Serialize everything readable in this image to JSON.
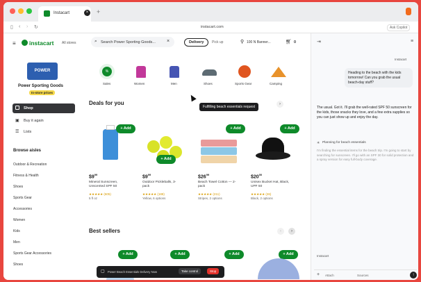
{
  "browser": {
    "tab_title": "Instacart",
    "url": "instacart.com",
    "right_pill": "Ask Copilot"
  },
  "header": {
    "logo": "instacart",
    "stores": "All stores",
    "search_placeholder": "Search Power Sporting Goods...",
    "delivery": "Delivery",
    "pickup": "Pick up",
    "address": "100 N Banner...",
    "cart_count": "0"
  },
  "store": {
    "badge": "POWER",
    "name": "Power Sporting Goods",
    "status": "In-store prices"
  },
  "nav": {
    "shop": "Shop",
    "buy_again": "Buy it again",
    "lists": "Lists"
  },
  "aisles": {
    "heading": "Browse aisles",
    "items": [
      "Outdoor & Recreation",
      "Fitness & Health",
      "Shoes",
      "Sports Gear",
      "Accessories",
      "Women",
      "Kids",
      "Men",
      "Sports Gear Accessories",
      "Shoes"
    ]
  },
  "categories": [
    {
      "label": "Sales",
      "icon": "sale-icon"
    },
    {
      "label": "Women",
      "icon": "shirt-icon"
    },
    {
      "label": "Men",
      "icon": "shirt-icon"
    },
    {
      "label": "Shoes",
      "icon": "shoe-icon"
    },
    {
      "label": "Sports Gear",
      "icon": "ball-icon"
    },
    {
      "label": "Camping",
      "icon": "tent-icon"
    }
  ],
  "deals": {
    "heading": "Deals for you",
    "tooltip": "Fulfilling beach essentials request",
    "add_label": "+ Add",
    "products": [
      {
        "price": "$9",
        "cents": "99",
        "name": "Mineral Sunscreen, Unscented SPF 50",
        "rating": "★★★★★ (605)",
        "detail": "5 fl oz"
      },
      {
        "price": "$9",
        "cents": "99",
        "name": "Outdoor Pickleballs, 3-pack",
        "rating": "★★★★★ (188)",
        "detail": "Yellow, 6 options"
      },
      {
        "price": "$26",
        "cents": "99",
        "name": "Beach Towel Cotton — 2-pack",
        "rating": "★★★★★ (211)",
        "detail": "Stripes, 2 options"
      },
      {
        "price": "$20",
        "cents": "00",
        "name": "Unisex Bucket Hat, Black, UPF 50",
        "rating": "★★★★★ (26)",
        "detail": "Black, 2 options"
      }
    ]
  },
  "best_sellers": {
    "heading": "Best sellers"
  },
  "bottom_bar": {
    "text": "Power Beach Essentials Delivery Now",
    "take_control": "Take control",
    "stop": "Stop"
  },
  "assistant": {
    "label_top": "Instacart",
    "user_message": "Heading to the beach with the kids tomorrow! Can you grab the usual beach-day stuff?",
    "reply": "The usual. Got it. I'll grab the well-rated SPF 50 sunscreen for the kids, those snacks they love, and a few extra supplies so you can just show up and enjoy the day.",
    "planning": "Planning for beach essentials",
    "planning_detail": "I'm finding the essential items for the beach trip. I'm going to start by searching for sunscreen. I'll go with an SPF 30 for solid protection and a spray version for easy full-body coverage.",
    "label_bottom": "Instacart",
    "input_left": "Attach",
    "input_mid": "Sources"
  },
  "colors": {
    "brand_green": "#0e8a2a",
    "background": "#e8463f",
    "store_badge": "#2d5fb0",
    "status_yellow": "#f5d84a"
  }
}
